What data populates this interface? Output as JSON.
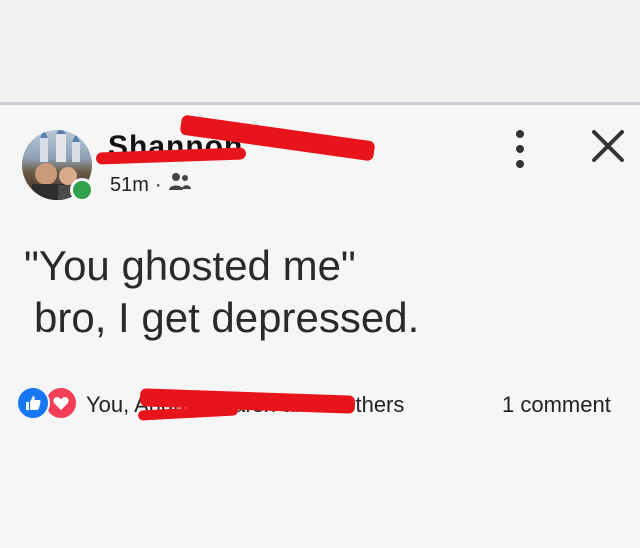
{
  "post": {
    "author_name": "Shannon",
    "time": "51m",
    "separator": "·",
    "privacy_icon": "friends-icon",
    "text_line1": "\"You ghosted me\"",
    "text_line2": "bro, I get depressed.",
    "reactions": {
      "icons": [
        "like-icon",
        "love-icon"
      ],
      "names": "You, Andrew Marsh and 4 others"
    },
    "comments": "1 comment"
  },
  "colors": {
    "like": "#1877f2",
    "love": "#f33e58",
    "online": "#31a24c",
    "redaction": "#e8141b"
  }
}
